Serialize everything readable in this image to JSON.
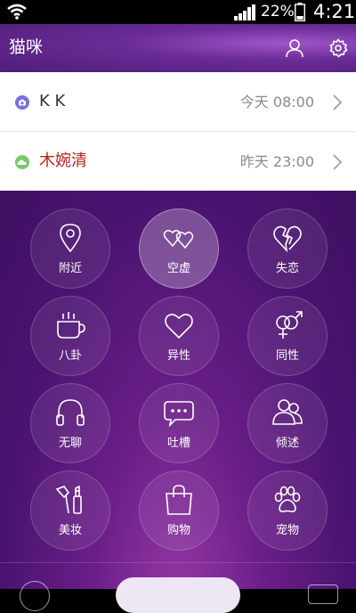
{
  "status_bar": {
    "battery_percent": "22%",
    "time": "4:21"
  },
  "app_bar": {
    "title": "猫咪"
  },
  "conversations": [
    {
      "name": "K K",
      "time": "今天 08:00",
      "name_color": "#333333",
      "dot_color": "#7a6fe0",
      "icon": "camera-icon"
    },
    {
      "name": "木婉清",
      "time": "昨天 23:00",
      "name_color": "#b8201e",
      "dot_color": "#7bc86a",
      "icon": "cloud-icon"
    }
  ],
  "categories": [
    {
      "label": "附近",
      "icon": "location-pin-icon"
    },
    {
      "label": "空虚",
      "icon": "linked-hearts-icon",
      "selected": true
    },
    {
      "label": "失恋",
      "icon": "broken-heart-icon"
    },
    {
      "label": "八卦",
      "icon": "coffee-cup-icon"
    },
    {
      "label": "异性",
      "icon": "heart-icon"
    },
    {
      "label": "同性",
      "icon": "gender-symbols-icon"
    },
    {
      "label": "无聊",
      "icon": "headphones-icon"
    },
    {
      "label": "吐槽",
      "icon": "chat-bubble-icon"
    },
    {
      "label": "倾述",
      "icon": "two-people-icon"
    },
    {
      "label": "美妆",
      "icon": "makeup-brush-icon"
    },
    {
      "label": "购物",
      "icon": "shopping-bag-icon"
    },
    {
      "label": "宠物",
      "icon": "paw-icon"
    }
  ]
}
